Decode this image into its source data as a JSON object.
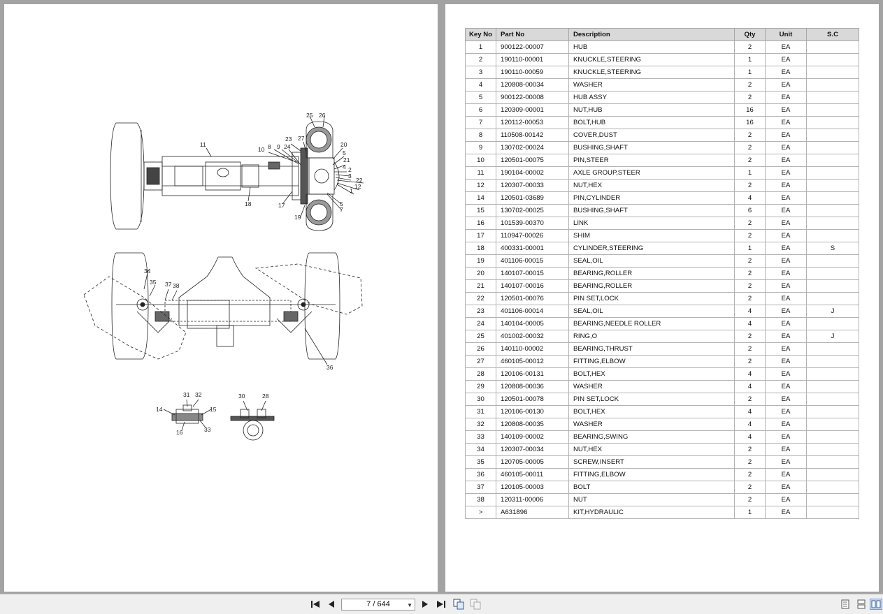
{
  "table": {
    "headers": [
      "Key No",
      "Part No",
      "Description",
      "Qty",
      "Unit",
      "S.C"
    ],
    "rows": [
      [
        "1",
        "900122-00007",
        "HUB",
        "2",
        "EA",
        ""
      ],
      [
        "2",
        "190110-00001",
        "KNUCKLE,STEERING",
        "1",
        "EA",
        ""
      ],
      [
        "3",
        "190110-00059",
        "KNUCKLE,STEERING",
        "1",
        "EA",
        ""
      ],
      [
        "4",
        "120808-00034",
        "WASHER",
        "2",
        "EA",
        ""
      ],
      [
        "5",
        "900122-00008",
        "HUB ASSY",
        "2",
        "EA",
        ""
      ],
      [
        "6",
        "120309-00001",
        "NUT,HUB",
        "16",
        "EA",
        ""
      ],
      [
        "7",
        "120112-00053",
        "BOLT,HUB",
        "16",
        "EA",
        ""
      ],
      [
        "8",
        "110508-00142",
        "COVER,DUST",
        "2",
        "EA",
        ""
      ],
      [
        "9",
        "130702-00024",
        "BUSHING,SHAFT",
        "2",
        "EA",
        ""
      ],
      [
        "10",
        "120501-00075",
        "PIN,STEER",
        "2",
        "EA",
        ""
      ],
      [
        "11",
        "190104-00002",
        "AXLE GROUP,STEER",
        "1",
        "EA",
        ""
      ],
      [
        "12",
        "120307-00033",
        "NUT,HEX",
        "2",
        "EA",
        ""
      ],
      [
        "14",
        "120501-03689",
        "PIN,CYLINDER",
        "4",
        "EA",
        ""
      ],
      [
        "15",
        "130702-00025",
        "BUSHING,SHAFT",
        "6",
        "EA",
        ""
      ],
      [
        "16",
        "101539-00370",
        "LINK",
        "2",
        "EA",
        ""
      ],
      [
        "17",
        "110947-00026",
        "SHIM",
        "2",
        "EA",
        ""
      ],
      [
        "18",
        "400331-00001",
        "CYLINDER,STEERING",
        "1",
        "EA",
        "S"
      ],
      [
        "19",
        "401106-00015",
        "SEAL,OIL",
        "2",
        "EA",
        ""
      ],
      [
        "20",
        "140107-00015",
        "BEARING,ROLLER",
        "2",
        "EA",
        ""
      ],
      [
        "21",
        "140107-00016",
        "BEARING,ROLLER",
        "2",
        "EA",
        ""
      ],
      [
        "22",
        "120501-00076",
        "PIN SET,LOCK",
        "2",
        "EA",
        ""
      ],
      [
        "23",
        "401106-00014",
        "SEAL,OIL",
        "4",
        "EA",
        "J"
      ],
      [
        "24",
        "140104-00005",
        "BEARING,NEEDLE ROLLER",
        "4",
        "EA",
        ""
      ],
      [
        "25",
        "401002-00032",
        "RING,O",
        "2",
        "EA",
        "J"
      ],
      [
        "26",
        "140110-00002",
        "BEARING,THRUST",
        "2",
        "EA",
        ""
      ],
      [
        "27",
        "460105-00012",
        "FITTING,ELBOW",
        "2",
        "EA",
        ""
      ],
      [
        "28",
        "120106-00131",
        "BOLT,HEX",
        "4",
        "EA",
        ""
      ],
      [
        "29",
        "120808-00036",
        "WASHER",
        "4",
        "EA",
        ""
      ],
      [
        "30",
        "120501-00078",
        "PIN SET,LOCK",
        "2",
        "EA",
        ""
      ],
      [
        "31",
        "120106-00130",
        "BOLT,HEX",
        "4",
        "EA",
        ""
      ],
      [
        "32",
        "120808-00035",
        "WASHER",
        "4",
        "EA",
        ""
      ],
      [
        "33",
        "140109-00002",
        "BEARING,SWING",
        "4",
        "EA",
        ""
      ],
      [
        "34",
        "120307-00034",
        "NUT,HEX",
        "2",
        "EA",
        ""
      ],
      [
        "35",
        "120705-00005",
        "SCREW,INSERT",
        "2",
        "EA",
        ""
      ],
      [
        "36",
        "460105-00011",
        "FITTING,ELBOW",
        "2",
        "EA",
        ""
      ],
      [
        "37",
        "120105-00003",
        "BOLT",
        "2",
        "EA",
        ""
      ],
      [
        "38",
        "120311-00006",
        "NUT",
        "2",
        "EA",
        ""
      ],
      [
        ">",
        "A631896",
        "KIT,HYDRAULIC",
        "1",
        "EA",
        ""
      ]
    ]
  },
  "diagram": {
    "callouts_top": [
      "25",
      "26",
      "11",
      "23",
      "27",
      "10",
      "8",
      "9",
      "24",
      "20",
      "5",
      "21",
      "4",
      "2",
      "3",
      "22",
      "12",
      "1",
      "18",
      "17",
      "19",
      "5",
      "7"
    ],
    "callouts_mid": [
      "34",
      "35",
      "37",
      "38",
      "36"
    ],
    "callouts_bottom": [
      "31",
      "32",
      "14",
      "15",
      "16",
      "33",
      "30",
      "28"
    ]
  },
  "toolbar": {
    "page_indicator": "7 / 644",
    "buttons": {
      "first": "skip-first-icon",
      "prev": "prev-page-icon",
      "next": "next-page-icon",
      "last": "skip-last-icon",
      "view_single": "single-page-icon",
      "view_continuous": "continuous-page-icon",
      "view_double": "two-page-icon"
    }
  }
}
